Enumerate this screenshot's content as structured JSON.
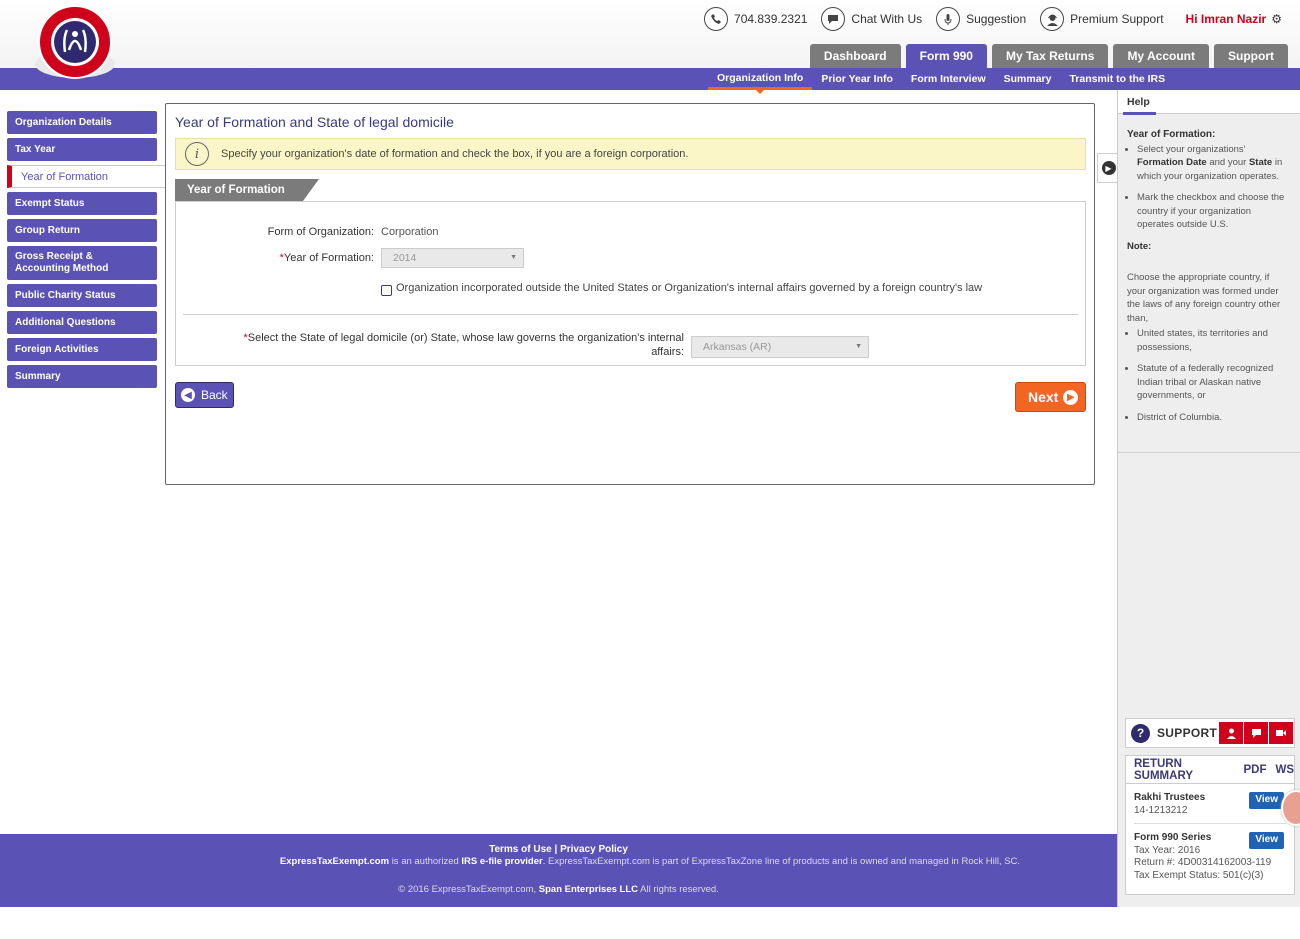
{
  "header": {
    "phone": "704.839.2321",
    "chat": "Chat With Us",
    "suggestion": "Suggestion",
    "premium_support": "Premium Support",
    "greeting": "Hi Imran Nazir"
  },
  "main_tabs": [
    "Dashboard",
    "Form 990",
    "My Tax Returns",
    "My Account",
    "Support"
  ],
  "active_main_tab": "Form 990",
  "subnav": [
    "Organization Info",
    "Prior Year Info",
    "Form Interview",
    "Summary",
    "Transmit to the IRS"
  ],
  "sidebar": [
    "Organization Details",
    "Tax Year",
    "Year of Formation",
    "Exempt Status",
    "Group Return",
    "Gross Receipt & Accounting Method",
    "Public Charity Status",
    "Additional Questions",
    "Foreign Activities",
    "Summary"
  ],
  "main": {
    "title": "Year of Formation and State of legal domicile",
    "info": "Specify your organization's date of formation and check the box, if you are a foreign corporation.",
    "section_tab": "Year of Formation",
    "form_org_label": "Form of Organization:",
    "form_org_value": "Corporation",
    "year_label": "Year of Formation:",
    "year_value": "2014",
    "foreign_checkbox_label": "Organization incorporated outside the United States or Organization's internal affairs governed by a foreign country's law",
    "state_label_line1": "Select the State of legal domicile (or) State, whose law governs the organization's internal",
    "state_label_line2": "affairs:",
    "state_value": "Arkansas (AR)",
    "required_mark": "*",
    "back_label": "Back",
    "next_label": "Next"
  },
  "help": {
    "tab": "Help",
    "section_title": "Year of Formation:",
    "bullet1_a": "Select your organizations'",
    "bullet1_b": "Formation Date",
    "bullet1_c": "and your",
    "bullet1_d": "State",
    "bullet1_e": "in which your organization operates.",
    "bullet2": "Mark the checkbox and choose the country if your organization operates outside U.S.",
    "note_title": "Note:",
    "note_text": "Choose the appropriate country, if your organization was formed under the laws of any foreign country other than,",
    "note_items": [
      "United states, its territories and possessions,",
      "Statute of a federally recognized Indian tribal or Alaskan native governments, or",
      "District of Columbia."
    ]
  },
  "support": {
    "label": "SUPPORT"
  },
  "return_summary": {
    "title": "RETURN SUMMARY",
    "pdf": "PDF",
    "ws": "WS",
    "org_name": "Rakhi Trustees",
    "org_ein": "14-1213212",
    "view_label": "View",
    "form_series": "Form 990 Series",
    "tax_year": "Tax Year: 2016",
    "return_no": "Return #: 4D00314162003-119",
    "exempt_status": "Tax Exempt Status: 501(c)(3)"
  },
  "footer": {
    "terms": "Terms of Use",
    "sep": "|",
    "privacy": "Privacy Policy",
    "site": "ExpressTaxExempt.com",
    "line_a": "is an authorized",
    "irs": "IRS e-file provider",
    "line_b": ". ExpressTaxExempt.com is part of ExpressTaxZone line of products and is owned and managed in Rock Hill, SC.",
    "copy_a": "© 2016 ExpressTaxExempt.com,",
    "company": "Span Enterprises LLC",
    "copy_b": "All rights reserved."
  },
  "colors": {
    "brand_purple": "#5b52b5",
    "accent_orange": "#f26522",
    "alert_red": "#d0021b",
    "info_yellow": "#fbf6c8"
  }
}
